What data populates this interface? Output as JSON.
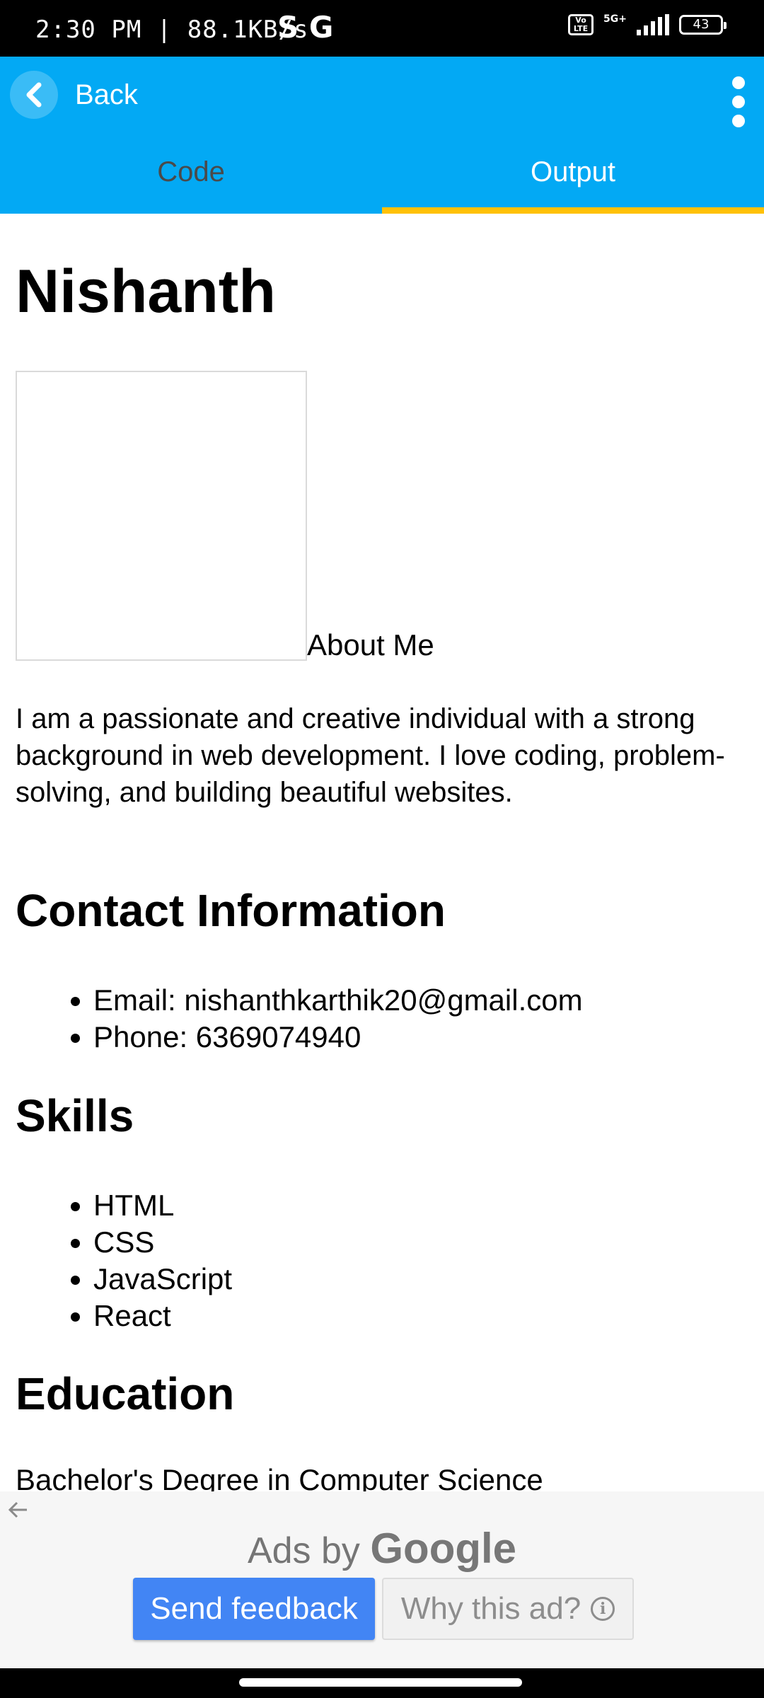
{
  "status_bar": {
    "time": "2:30 PM | 88.1KB/s",
    "app_icons": "S G",
    "network_badge": "Vo LTE",
    "network_type": "5G+",
    "battery": "43"
  },
  "app_bar": {
    "back_label": "Back",
    "tabs": [
      {
        "label": "Code",
        "active": false
      },
      {
        "label": "Output",
        "active": true
      }
    ],
    "accent_color": "#03a9f4",
    "indicator_color": "#ffc107"
  },
  "page": {
    "name": "Nishanth",
    "about_heading": "About Me",
    "about_text": "I am a passionate and creative individual with a strong background in web development. I love coding, problem-solving, and building beautiful websites.",
    "contact_heading": "Contact Information",
    "contact_items": [
      "Email: nishanthkarthik20@gmail.com",
      "Phone: 6369074940"
    ],
    "skills_heading": "Skills",
    "skills": [
      "HTML",
      "CSS",
      "JavaScript",
      "React"
    ],
    "education_heading": "Education",
    "education_line": "Bachelor's Degree in Computer Science"
  },
  "ad": {
    "ads_by": "Ads by",
    "google": "Google",
    "send_feedback": "Send feedback",
    "why_this_ad": "Why this ad?",
    "button_color": "#4285f4"
  }
}
